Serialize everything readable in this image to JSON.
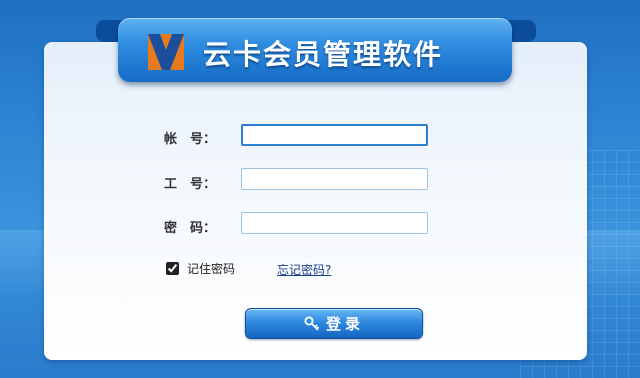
{
  "app": {
    "title": "云卡会员管理软件",
    "logo": "vy-logo-icon"
  },
  "form": {
    "account_label": "帐　号：",
    "account_value": "",
    "employee_label": "工　号：",
    "employee_value": "",
    "password_label": "密　码：",
    "password_value": ""
  },
  "remember": {
    "label": "记住密码",
    "checked": true
  },
  "forgot_link": "忘记密码?",
  "login": {
    "label": "登录",
    "icon": "key-icon"
  },
  "colors": {
    "accent": "#2f8de0",
    "ribbon_dark": "#0b4d9c",
    "link": "#1a3d8a"
  }
}
